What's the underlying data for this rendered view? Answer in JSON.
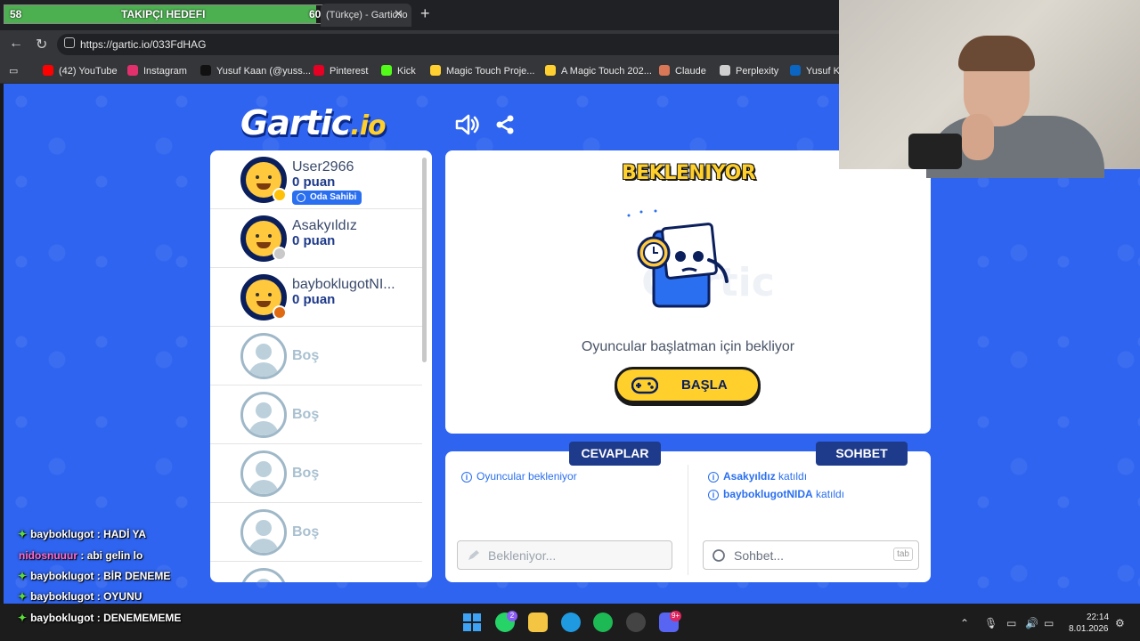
{
  "overlay": {
    "follow_current": "58",
    "follow_label": "TAKIPÇI HEDEFI",
    "follow_target": "60",
    "follow_progress": 0.967
  },
  "browser": {
    "tab_title": "(Türkçe) - Gartic.io",
    "url": "https://gartic.io/033FdHAG",
    "bookmarks": [
      {
        "label": "(42) YouTube",
        "icon": "youtube-icon",
        "color": "#ff0000"
      },
      {
        "label": "Instagram",
        "icon": "instagram-icon",
        "color": "#e1306c"
      },
      {
        "label": "Yusuf Kaan (@yuss...",
        "icon": "tiktok-icon",
        "color": "#111111"
      },
      {
        "label": "Pinterest",
        "icon": "pinterest-icon",
        "color": "#e60023"
      },
      {
        "label": "Kick",
        "icon": "kick-icon",
        "color": "#53fc18"
      },
      {
        "label": "Magic Touch Proje...",
        "icon": "miro-icon",
        "color": "#ffd02f"
      },
      {
        "label": "A Magic Touch 202...",
        "icon": "miro-icon",
        "color": "#ffd02f"
      },
      {
        "label": "Claude",
        "icon": "claude-icon",
        "color": "#d97757"
      },
      {
        "label": "Perplexity",
        "icon": "perplexity-icon",
        "color": "#cfcfcf"
      },
      {
        "label": "Yusuf Ka",
        "icon": "linkedin-icon",
        "color": "#0a66c2"
      }
    ]
  },
  "game": {
    "logo_main": "Gartic",
    "logo_suffix": ".io",
    "status_title": "BEKLENIYOR",
    "status_message": "Oyuncular başlatman için bekliyor",
    "start_button": "BAŞLA",
    "players": [
      {
        "name": "User2966",
        "score": "0 puan",
        "badge": "Oda Sahibi",
        "dot_color": "#ffc107"
      },
      {
        "name": "Asakyıldız",
        "score": "0 puan",
        "dot_color": "#c9c9c9"
      },
      {
        "name": "bayboklugotNI...",
        "score": "0 puan",
        "dot_color": "#e06a12"
      }
    ],
    "empty_slots": [
      "Boş",
      "Boş",
      "Boş",
      "Boş"
    ],
    "answers_tab": "CEVAPLAR",
    "chat_tab": "SOHBET",
    "answers_info": "Oyuncular bekleniyor",
    "chat_events": [
      {
        "name": "Asakyıldız",
        "action": "katıldı"
      },
      {
        "name": "bayboklugotNIDA",
        "action": "katıldı"
      }
    ],
    "answer_placeholder": "Bekleniyor...",
    "chat_placeholder": "Sohbet...",
    "chat_shortcut": "tab"
  },
  "stream_chat": [
    {
      "user": "bayboklugot",
      "message": ": HADİ YA",
      "badge": true
    },
    {
      "user": "nidosnuuur",
      "message": ": abi gelin lo",
      "badge": false
    },
    {
      "user": "bayboklugot",
      "message": ": BİR DENEME",
      "badge": true
    },
    {
      "user": "bayboklugot",
      "message": ": OYUNU",
      "badge": true
    },
    {
      "user": "bayboklugot",
      "message": ": DENEMEMEME",
      "badge": true
    }
  ],
  "taskbar": {
    "whatsapp_badge": "2",
    "discord_badge": "9+",
    "time": "22:14",
    "date": "8.01.2026"
  }
}
